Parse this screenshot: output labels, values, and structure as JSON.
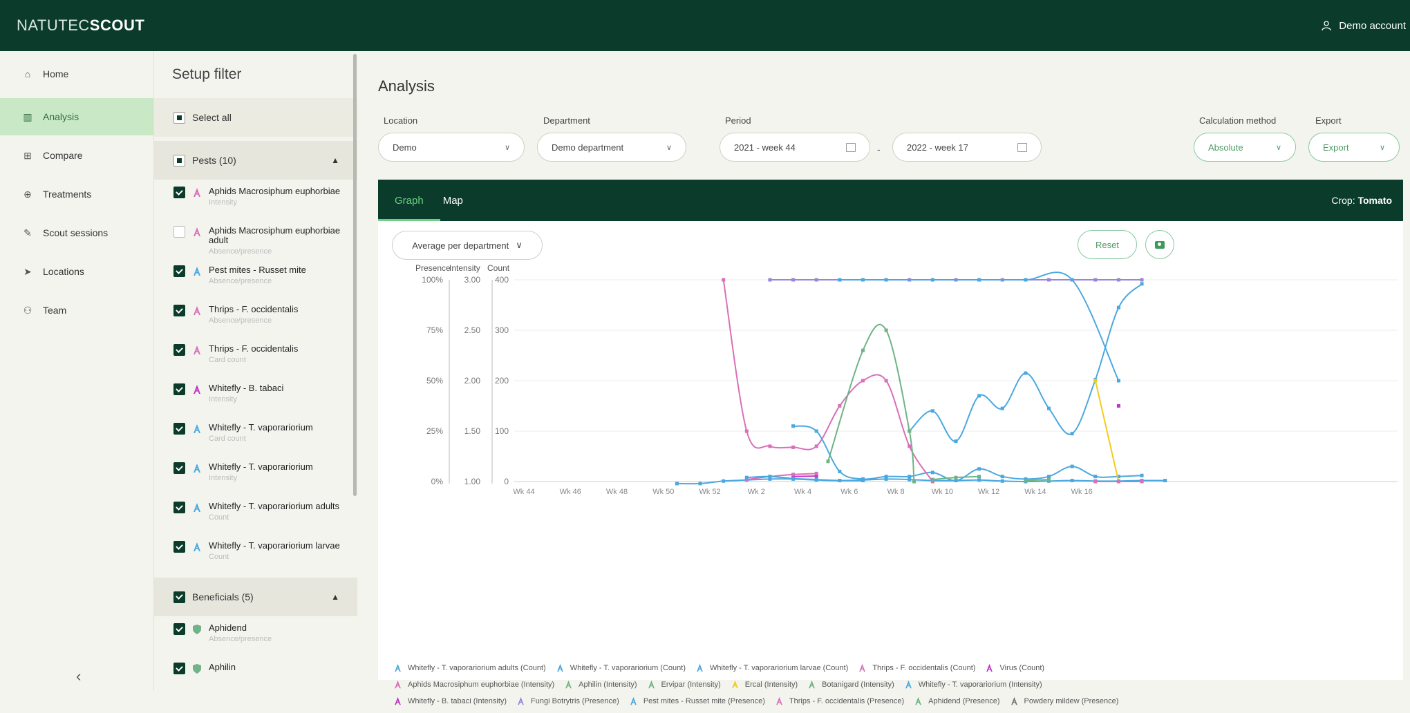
{
  "header": {
    "logo_light": "NATUTEC",
    "logo_bold": "SCOUT",
    "account": "Demo account"
  },
  "nav": {
    "items": [
      {
        "label": "Home",
        "icon": "home-icon"
      },
      {
        "label": "Analysis",
        "icon": "chart-icon"
      },
      {
        "label": "Compare",
        "icon": "grid-icon"
      },
      {
        "label": "Treatments",
        "icon": "treatment-icon"
      },
      {
        "label": "Scout sessions",
        "icon": "edit-icon"
      },
      {
        "label": "Locations",
        "icon": "send-icon"
      },
      {
        "label": "Team",
        "icon": "team-icon"
      }
    ],
    "collapse_glyph": "‹"
  },
  "filter": {
    "title": "Setup filter",
    "select_all": "Select all",
    "pests_header": "Pests (10)",
    "items": [
      {
        "name": "Aphids Macrosiphum euphorbiae",
        "sub": "Intensity",
        "checked": true,
        "color": "#d96fb8"
      },
      {
        "name": "Aphids Macrosiphum euphorbiae adult",
        "sub": "Absence/presence",
        "checked": false,
        "color": "#d96fb8"
      },
      {
        "name": "Pest mites - Russet mite",
        "sub": "Absence/presence",
        "checked": true,
        "color": "#4aa8e0"
      },
      {
        "name": "Thrips - F. occidentalis",
        "sub": "Absence/presence",
        "checked": true,
        "color": "#d96fb8"
      },
      {
        "name": "Thrips - F. occidentalis",
        "sub": "Card count",
        "checked": true,
        "color": "#d96fb8"
      },
      {
        "name": "Whitefly - B. tabaci",
        "sub": "Intensity",
        "checked": true,
        "color": "#c035c8"
      },
      {
        "name": "Whitefly - T. vaporariorium",
        "sub": "Card count",
        "checked": true,
        "color": "#4aa8e0"
      },
      {
        "name": "Whitefly - T. vaporariorium",
        "sub": "Intensity",
        "checked": true,
        "color": "#4aa8e0"
      },
      {
        "name": "Whitefly - T. vaporariorium adults",
        "sub": "Count",
        "checked": true,
        "color": "#4aa8e0"
      },
      {
        "name": "Whitefly - T. vaporariorium larvae",
        "sub": "Count",
        "checked": true,
        "color": "#4aa8e0"
      }
    ],
    "beneficials_header": "Beneficials (5)",
    "beneficials": [
      {
        "name": "Aphidend",
        "sub": "Absence/presence"
      },
      {
        "name": "Aphilin",
        "sub": ""
      }
    ]
  },
  "main": {
    "title": "Analysis",
    "location_label": "Location",
    "location_value": "Demo",
    "department_label": "Department",
    "department_value": "Demo department",
    "period_label": "Period",
    "period_from": "2021 - week 44",
    "period_to": "2022 - week 17",
    "period_separator": "-",
    "calc_label": "Calculation method",
    "calc_value": "Absolute",
    "export_label": "Export",
    "export_value": "Export",
    "tab_graph": "Graph",
    "tab_map": "Map",
    "crop_label": "Crop:",
    "crop_value": "Tomato",
    "avg_button": "Average per department",
    "reset_button": "Reset"
  },
  "colors": {
    "brand": "#0a3b2b",
    "accent": "#6fcf87",
    "blue": "#4aa8e0",
    "pink": "#d96fb8",
    "green": "#6fb386",
    "purple": "#9a86d8",
    "yellow": "#f2cc1c",
    "magenta": "#c035c8"
  },
  "chart_data": {
    "type": "line",
    "axes": {
      "presence": {
        "title": "Presence",
        "ticks": [
          "100%",
          "75%",
          "50%",
          "25%",
          "0%"
        ],
        "range": [
          0,
          100
        ]
      },
      "intensity": {
        "title": "Intensity",
        "ticks": [
          "3.00",
          "2.50",
          "2.00",
          "1.50",
          "1.00"
        ],
        "range": [
          1,
          3
        ]
      },
      "count": {
        "title": "Count",
        "ticks": [
          "400",
          "300",
          "200",
          "100",
          "0"
        ],
        "range": [
          0,
          400
        ]
      }
    },
    "x_ticks": [
      "Wk 44",
      "Wk 46",
      "Wk 48",
      "Wk 50",
      "Wk 52",
      "Wk 2",
      "Wk 4",
      "Wk 6",
      "Wk 8",
      "Wk 10",
      "Wk 12",
      "Wk 14",
      "Wk 16"
    ],
    "series": [
      {
        "name": "Whitefly - T. vaporariorium adults (Count)",
        "color": "#4aa8e0",
        "axis": "count",
        "points": [
          [
            7,
            -4
          ],
          [
            8,
            -4
          ],
          [
            9,
            1
          ],
          [
            10,
            3
          ],
          [
            11,
            5
          ],
          [
            12,
            5
          ],
          [
            13,
            3
          ],
          [
            14,
            2
          ],
          [
            15,
            3
          ],
          [
            16,
            5
          ],
          [
            17,
            4
          ],
          [
            18,
            2
          ],
          [
            19,
            2
          ],
          [
            20,
            3
          ],
          [
            21,
            1
          ],
          [
            22,
            0
          ],
          [
            23,
            1
          ],
          [
            24,
            2
          ],
          [
            25,
            1
          ],
          [
            26,
            1
          ],
          [
            27,
            2
          ],
          [
            28,
            2
          ]
        ]
      },
      {
        "name": "Whitefly - T. vaporariorium (Count)",
        "color": "#4aa8e0",
        "axis": "count",
        "points": [
          [
            17,
            100
          ],
          [
            18,
            140
          ],
          [
            19,
            80
          ],
          [
            20,
            170
          ],
          [
            21,
            145
          ],
          [
            22,
            215
          ],
          [
            23,
            145
          ],
          [
            24,
            95
          ],
          [
            25,
            202
          ],
          [
            26,
            345
          ],
          [
            27,
            392
          ]
        ]
      },
      {
        "name": "Whitefly - T. vaporariorium larvae (Count)",
        "color": "#4aa8e0",
        "axis": "count",
        "points": [
          [
            12,
            110
          ],
          [
            13,
            100
          ],
          [
            14,
            20
          ],
          [
            15,
            5
          ],
          [
            16,
            10
          ],
          [
            17,
            10
          ],
          [
            18,
            18
          ],
          [
            19,
            2
          ],
          [
            20,
            25
          ],
          [
            21,
            10
          ],
          [
            22,
            5
          ],
          [
            23,
            10
          ],
          [
            24,
            30
          ],
          [
            25,
            10
          ],
          [
            26,
            10
          ],
          [
            27,
            12
          ]
        ]
      },
      {
        "name": "Thrips - F. occidentalis (Count)",
        "color": "#d96fb8",
        "axis": "count",
        "points": [
          [
            9,
            400
          ],
          [
            10,
            100
          ],
          [
            11,
            70
          ],
          [
            12,
            68
          ],
          [
            13,
            70
          ],
          [
            14,
            150
          ],
          [
            15,
            200
          ],
          [
            16,
            200
          ],
          [
            17,
            70
          ],
          [
            18,
            0
          ]
        ]
      },
      {
        "name": "Virus (Count)",
        "color": "#c035c8",
        "axis": "count",
        "points": [
          [
            12,
            10
          ],
          [
            13,
            11
          ]
        ]
      },
      {
        "name": "Aphids Macrosiphum euphorbiae (Intensity)",
        "color": "#d96fb8",
        "axis": "intensity",
        "points": [
          [
            10,
            1.02
          ],
          [
            11,
            1.05
          ],
          [
            12,
            1.07
          ],
          [
            13,
            1.08
          ]
        ]
      },
      {
        "name": "Aphilin (Intensity)",
        "color": "#6fb386",
        "axis": "intensity",
        "points": [
          [
            13.5,
            1.2
          ],
          [
            15,
            2.3
          ],
          [
            16,
            2.5
          ],
          [
            17,
            1.5
          ],
          [
            17.2,
            1.0
          ]
        ]
      },
      {
        "name": "Ervipar (Intensity)",
        "color": "#6fb386",
        "axis": "intensity",
        "points": [
          [
            18,
            1.02
          ],
          [
            19,
            1.04
          ],
          [
            20,
            1.05
          ]
        ]
      },
      {
        "name": "Ercal (Intensity)",
        "color": "#f2cc1c",
        "axis": "intensity",
        "points": [
          [
            25,
            2.0
          ],
          [
            26,
            1.0
          ]
        ]
      },
      {
        "name": "Botanigard (Intensity)",
        "color": "#6fb386",
        "axis": "intensity",
        "points": [
          [
            22,
            1.01
          ],
          [
            23,
            1.02
          ]
        ]
      },
      {
        "name": "Whitefly - T. vaporariorium (Intensity)",
        "color": "#4aa8e0",
        "axis": "intensity",
        "points": [
          [
            10,
            1.04
          ],
          [
            11,
            1.05
          ],
          [
            12,
            1.03
          ],
          [
            13,
            1.02
          ],
          [
            14,
            1.01
          ],
          [
            15,
            1.01
          ]
        ]
      },
      {
        "name": "Whitefly - B. tabaci (Intensity)",
        "color": "#c035c8",
        "axis": "intensity",
        "points": [
          [
            26,
            1.75
          ]
        ]
      },
      {
        "name": "Fungi Botrytris (Presence)",
        "color": "#9a86d8",
        "axis": "presence",
        "points": [
          [
            11,
            100
          ],
          [
            12,
            100
          ],
          [
            13,
            100
          ],
          [
            14,
            100
          ],
          [
            15,
            100
          ],
          [
            16,
            100
          ],
          [
            17,
            100
          ],
          [
            18,
            100
          ],
          [
            19,
            100
          ],
          [
            20,
            100
          ],
          [
            21,
            100
          ],
          [
            22,
            100
          ],
          [
            23,
            100
          ],
          [
            24,
            100
          ],
          [
            25,
            100
          ],
          [
            26,
            100
          ],
          [
            27,
            100
          ]
        ]
      },
      {
        "name": "Pest mites - Russet mite (Presence)",
        "color": "#4aa8e0",
        "axis": "presence",
        "points": [
          [
            14,
            100
          ],
          [
            15,
            100
          ],
          [
            16,
            100
          ],
          [
            18,
            100
          ],
          [
            20,
            100
          ],
          [
            22,
            100
          ],
          [
            24,
            100
          ],
          [
            26,
            50
          ]
        ]
      },
      {
        "name": "Thrips - F. occidentalis (Presence)",
        "color": "#d96fb8",
        "axis": "presence",
        "points": [
          [
            25,
            0
          ],
          [
            26,
            0
          ],
          [
            27,
            0
          ]
        ]
      },
      {
        "name": "Aphidend (Presence)",
        "color": "#6fb386",
        "axis": "presence",
        "points": []
      },
      {
        "name": "Powdery mildew (Presence)",
        "color": "#777777",
        "axis": "presence",
        "points": []
      }
    ],
    "legend_rows": [
      [
        0,
        1,
        2,
        3,
        4
      ],
      [
        5,
        6,
        7,
        8,
        9,
        10
      ],
      [
        11,
        12,
        13,
        14,
        15,
        16
      ]
    ]
  }
}
